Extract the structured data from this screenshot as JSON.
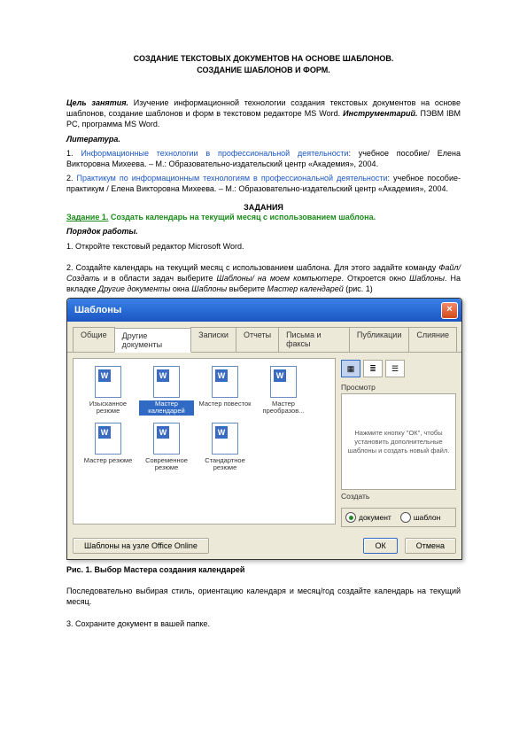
{
  "title_line1": "СОЗДАНИЕ ТЕКСТОВЫХ ДОКУМЕНТОВ НА ОСНОВЕ ШАБЛОНОВ.",
  "title_line2": "СОЗДАНИЕ ШАБЛОНОВ И ФОРМ.",
  "goal_label": "Цель занятия.",
  "goal_text": " Изучение информационной технологии создания текстовых документов на основе шаблонов, создание шаблонов и форм в текстовом редакторе MS Word. ",
  "goal_instr": "Инструментарий.",
  "goal_instr_text": " ПЭВМ IBM PC, программа MS Word.",
  "lit_label": "Литература.",
  "lit1_num": "1. ",
  "lit1_link": "Информационные технологии в профессиональной деятельности",
  "lit1_rest": ": учебное пособие/ Елена Викторовна Михеева. – М.: Образовательно-издательский центр «Академия», 2004.",
  "lit2_num": "2. ",
  "lit2_link": "Практикум по информационным технологиям в профессиональной деятельности",
  "lit2_rest": ": учебное пособие-практикум / Елена Викторовна Михеева. – М.: Образовательно-издательский центр «Академия», 2004.",
  "tasks_header": "ЗАДАНИЯ",
  "task1_title_a": "Задание 1.",
  "task1_title_b": " Создать календарь на текущий месяц с использованием шаблона.",
  "order_label": "Порядок работы.",
  "step1": "1. Откройте текстовый редактор Microsoft Word.",
  "step2_a": "2. Создайте календарь на текущий месяц с использованием шаблона. Для этого задайте команду ",
  "step2_b": "Файл/ Создать",
  "step2_c": " и в области задач выберите ",
  "step2_d": "Шаблоны/ на моем компьютере",
  "step2_e": ". Откроется окно ",
  "step2_f": "Шаблоны",
  "step2_g": ". На вкладке ",
  "step2_h": "Другие документы",
  "step2_i": " окна ",
  "step2_j": "Шаблоны",
  "step2_k": " выберите ",
  "step2_l": "Мастер календарей",
  "step2_m": " (рис. 1)",
  "fig_caption": "Рис. 1. Выбор Мастера создания календарей",
  "after_fig": "Последовательно выбирая стиль, ориентацию календаря и месяц/год создайте календарь на текущий месяц.",
  "step3": "3. Сохраните документ в вашей папке.",
  "dialog": {
    "title": "Шаблоны",
    "tabs": [
      "Общие",
      "Другие документы",
      "Записки",
      "Отчеты",
      "Письма и факсы",
      "Публикации",
      "Слияние"
    ],
    "active_tab": "Другие документы",
    "files": [
      {
        "label": "Изысканное резюме"
      },
      {
        "label": "Мастер календарей",
        "selected": true
      },
      {
        "label": "Мастер повесток"
      },
      {
        "label": "Мастер преобразов..."
      },
      {
        "label": "Мастер резюме"
      },
      {
        "label": "Современное резюме"
      },
      {
        "label": "Стандартное резюме"
      }
    ],
    "preview_label": "Просмотр",
    "preview_text": "Нажмите кнопку \"ОК\", чтобы установить дополнительные шаблоны и создать новый файл.",
    "create_label": "Создать",
    "radio_doc": "документ",
    "radio_tpl": "шаблон",
    "office_online": "Шаблоны на узле Office Online",
    "ok": "ОК",
    "cancel": "Отмена"
  }
}
